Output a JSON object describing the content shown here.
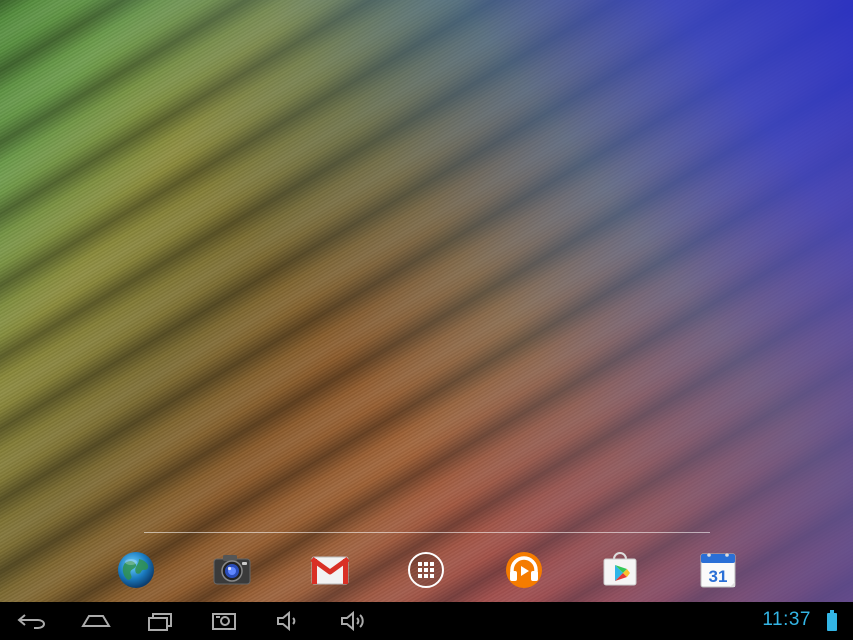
{
  "screen": {
    "name": "android-home-screen"
  },
  "dock": {
    "apps": [
      {
        "name": "browser",
        "icon": "globe-icon"
      },
      {
        "name": "camera",
        "icon": "camera-icon"
      },
      {
        "name": "gmail",
        "icon": "gmail-icon"
      },
      {
        "name": "all-apps",
        "icon": "app-drawer-icon"
      },
      {
        "name": "play-music",
        "icon": "headphones-icon"
      },
      {
        "name": "play-store",
        "icon": "play-store-icon"
      },
      {
        "name": "calendar",
        "icon": "calendar-icon",
        "label": "31"
      }
    ]
  },
  "navbar": {
    "buttons": [
      {
        "name": "back",
        "icon": "back-icon"
      },
      {
        "name": "home",
        "icon": "home-icon"
      },
      {
        "name": "recent-apps",
        "icon": "recents-icon"
      },
      {
        "name": "screenshot",
        "icon": "screenshot-icon"
      },
      {
        "name": "volume-down",
        "icon": "volume-down-icon"
      },
      {
        "name": "volume-up",
        "icon": "volume-up-icon"
      }
    ],
    "status": {
      "time": "11:37",
      "battery_icon": "battery-icon"
    }
  },
  "colors": {
    "clock": "#33b5e5",
    "accent": "#33b5e5"
  }
}
